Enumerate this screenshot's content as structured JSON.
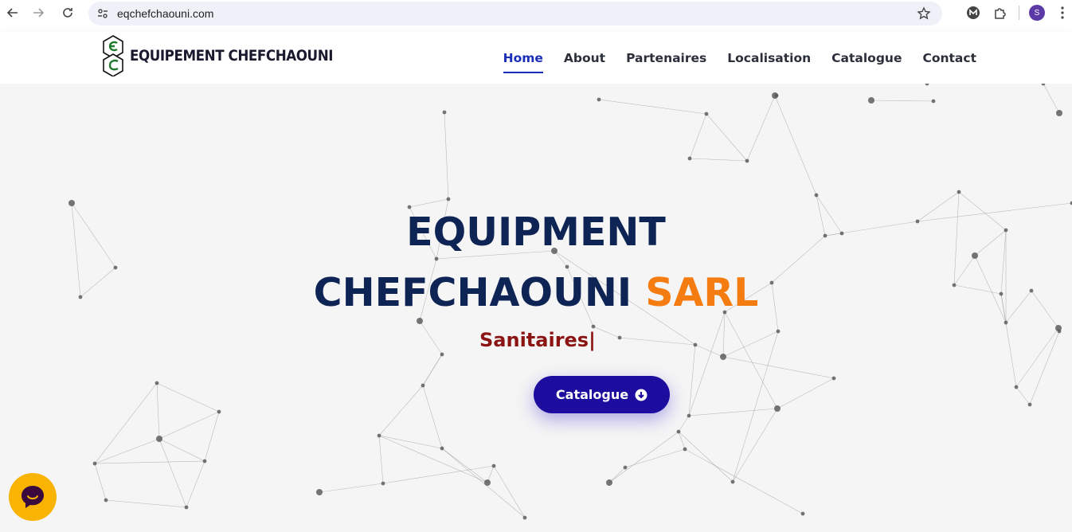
{
  "browser": {
    "url": "eqchefchaouni.com",
    "profile_initial": "S",
    "icons": [
      "back-arrow-icon",
      "forward-arrow-icon",
      "reload-icon",
      "site-settings-icon",
      "bookmark-star-icon",
      "extension-m-icon",
      "extensions-puzzle-icon",
      "kebab-menu-icon"
    ]
  },
  "header": {
    "logo_text": "EQUIPEMENT CHEFCHAOUNI",
    "nav": [
      {
        "label": "Home",
        "active": true
      },
      {
        "label": "About",
        "active": false
      },
      {
        "label": "Partenaires",
        "active": false
      },
      {
        "label": "Localisation",
        "active": false
      },
      {
        "label": "Catalogue",
        "active": false
      },
      {
        "label": "Contact",
        "active": false
      }
    ]
  },
  "hero": {
    "title_line1": "EQUIPMENT",
    "title_line2_main": "CHEFCHAOUNI",
    "title_line2_accent": "SARL",
    "subtitle": "Sanitaires|",
    "cta_label": "Catalogue",
    "cta_icon": "arrow-down-circle-icon"
  },
  "chat_widget": {
    "icon": "chat-bubble-icon"
  },
  "colors": {
    "title": "#0e2455",
    "accent": "#f57c10",
    "subtitle": "#8b1414",
    "cta": "#1c0d9e",
    "nav_active": "#1a2fb8",
    "chat": "#f8b400"
  }
}
